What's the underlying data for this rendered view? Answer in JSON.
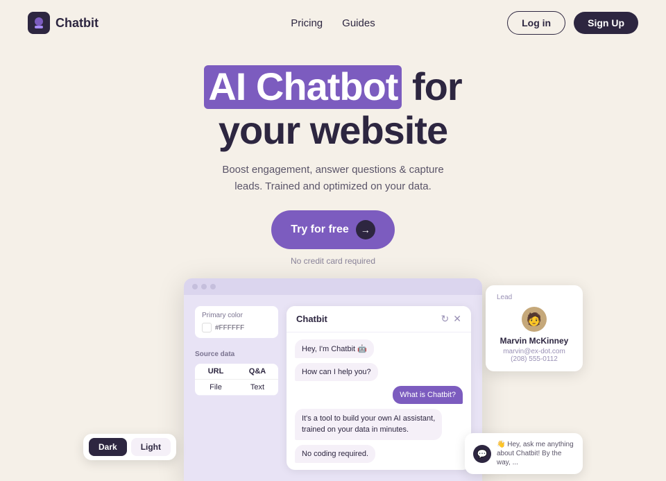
{
  "nav": {
    "logo_text": "Chatbit",
    "link_pricing": "Pricing",
    "link_guides": "Guides",
    "btn_login": "Log in",
    "btn_signup": "Sign Up"
  },
  "hero": {
    "title_part1": "AI Chatbot",
    "title_part2": "for",
    "title_line2": "your website",
    "subtitle_line1": "Boost engagement, answer questions & capture",
    "subtitle_line2": "leads. Trained and optimized on your data.",
    "cta_label": "Try for free",
    "cta_note": "No credit card required"
  },
  "dashboard": {
    "primary_color_label": "Primary color",
    "primary_color_hex": "#FFFFFF",
    "source_label": "Source data",
    "source_columns": [
      "URL",
      "Q&A"
    ],
    "source_row1": [
      "File",
      "Text"
    ],
    "chat_title": "Chatbit",
    "msg1": "Hey, I'm Chatbit 🤖",
    "msg2": "How can I help you?",
    "msg3": "What is Chatbit?",
    "msg4_line1": "It's a tool to build your own AI assistant,",
    "msg4_line2": "trained on your data in minutes.",
    "msg5": "No coding required.",
    "lead_label": "Lead",
    "lead_name": "Marvin McKinney",
    "lead_email": "marvin@ex-dot.com",
    "lead_phone": "(208) 555-0112",
    "theme_dark": "Dark",
    "theme_light": "Light",
    "chat_preview": "👋 Hey, ask me anything about Chatbit! By the way, ..."
  }
}
